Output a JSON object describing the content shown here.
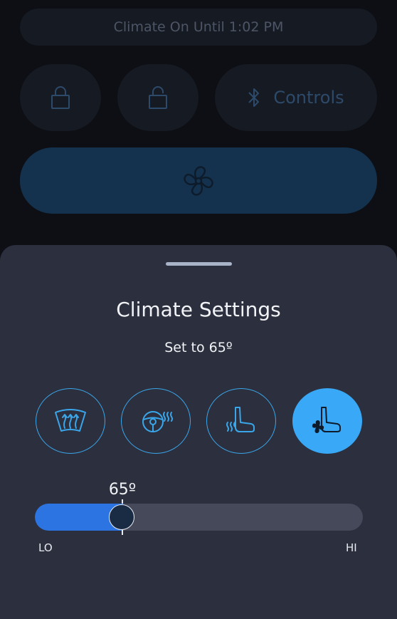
{
  "status": {
    "text": "Climate On Until 1:02 PM"
  },
  "top_controls": {
    "lock_icon": "lock-icon",
    "unlock_icon": "unlock-icon",
    "bluetooth_icon": "bluetooth-icon",
    "controls_label": "Controls",
    "fan_icon": "fan-icon"
  },
  "sheet": {
    "title": "Climate Settings",
    "subtitle": "Set to 65º",
    "modes": [
      {
        "icon": "windshield-defrost-icon",
        "active": false
      },
      {
        "icon": "heated-steering-wheel-icon",
        "active": false
      },
      {
        "icon": "heated-seat-icon",
        "active": false
      },
      {
        "icon": "ventilated-seat-icon",
        "active": true
      }
    ],
    "slider": {
      "value_label": "65º",
      "value_fraction": 0.27,
      "min_label": "LO",
      "max_label": "HI"
    }
  },
  "colors": {
    "background": "#0d0f14",
    "sheet": "#2c2f3e",
    "accent": "#39a9f7",
    "slider_fill": "#2c74e2"
  }
}
